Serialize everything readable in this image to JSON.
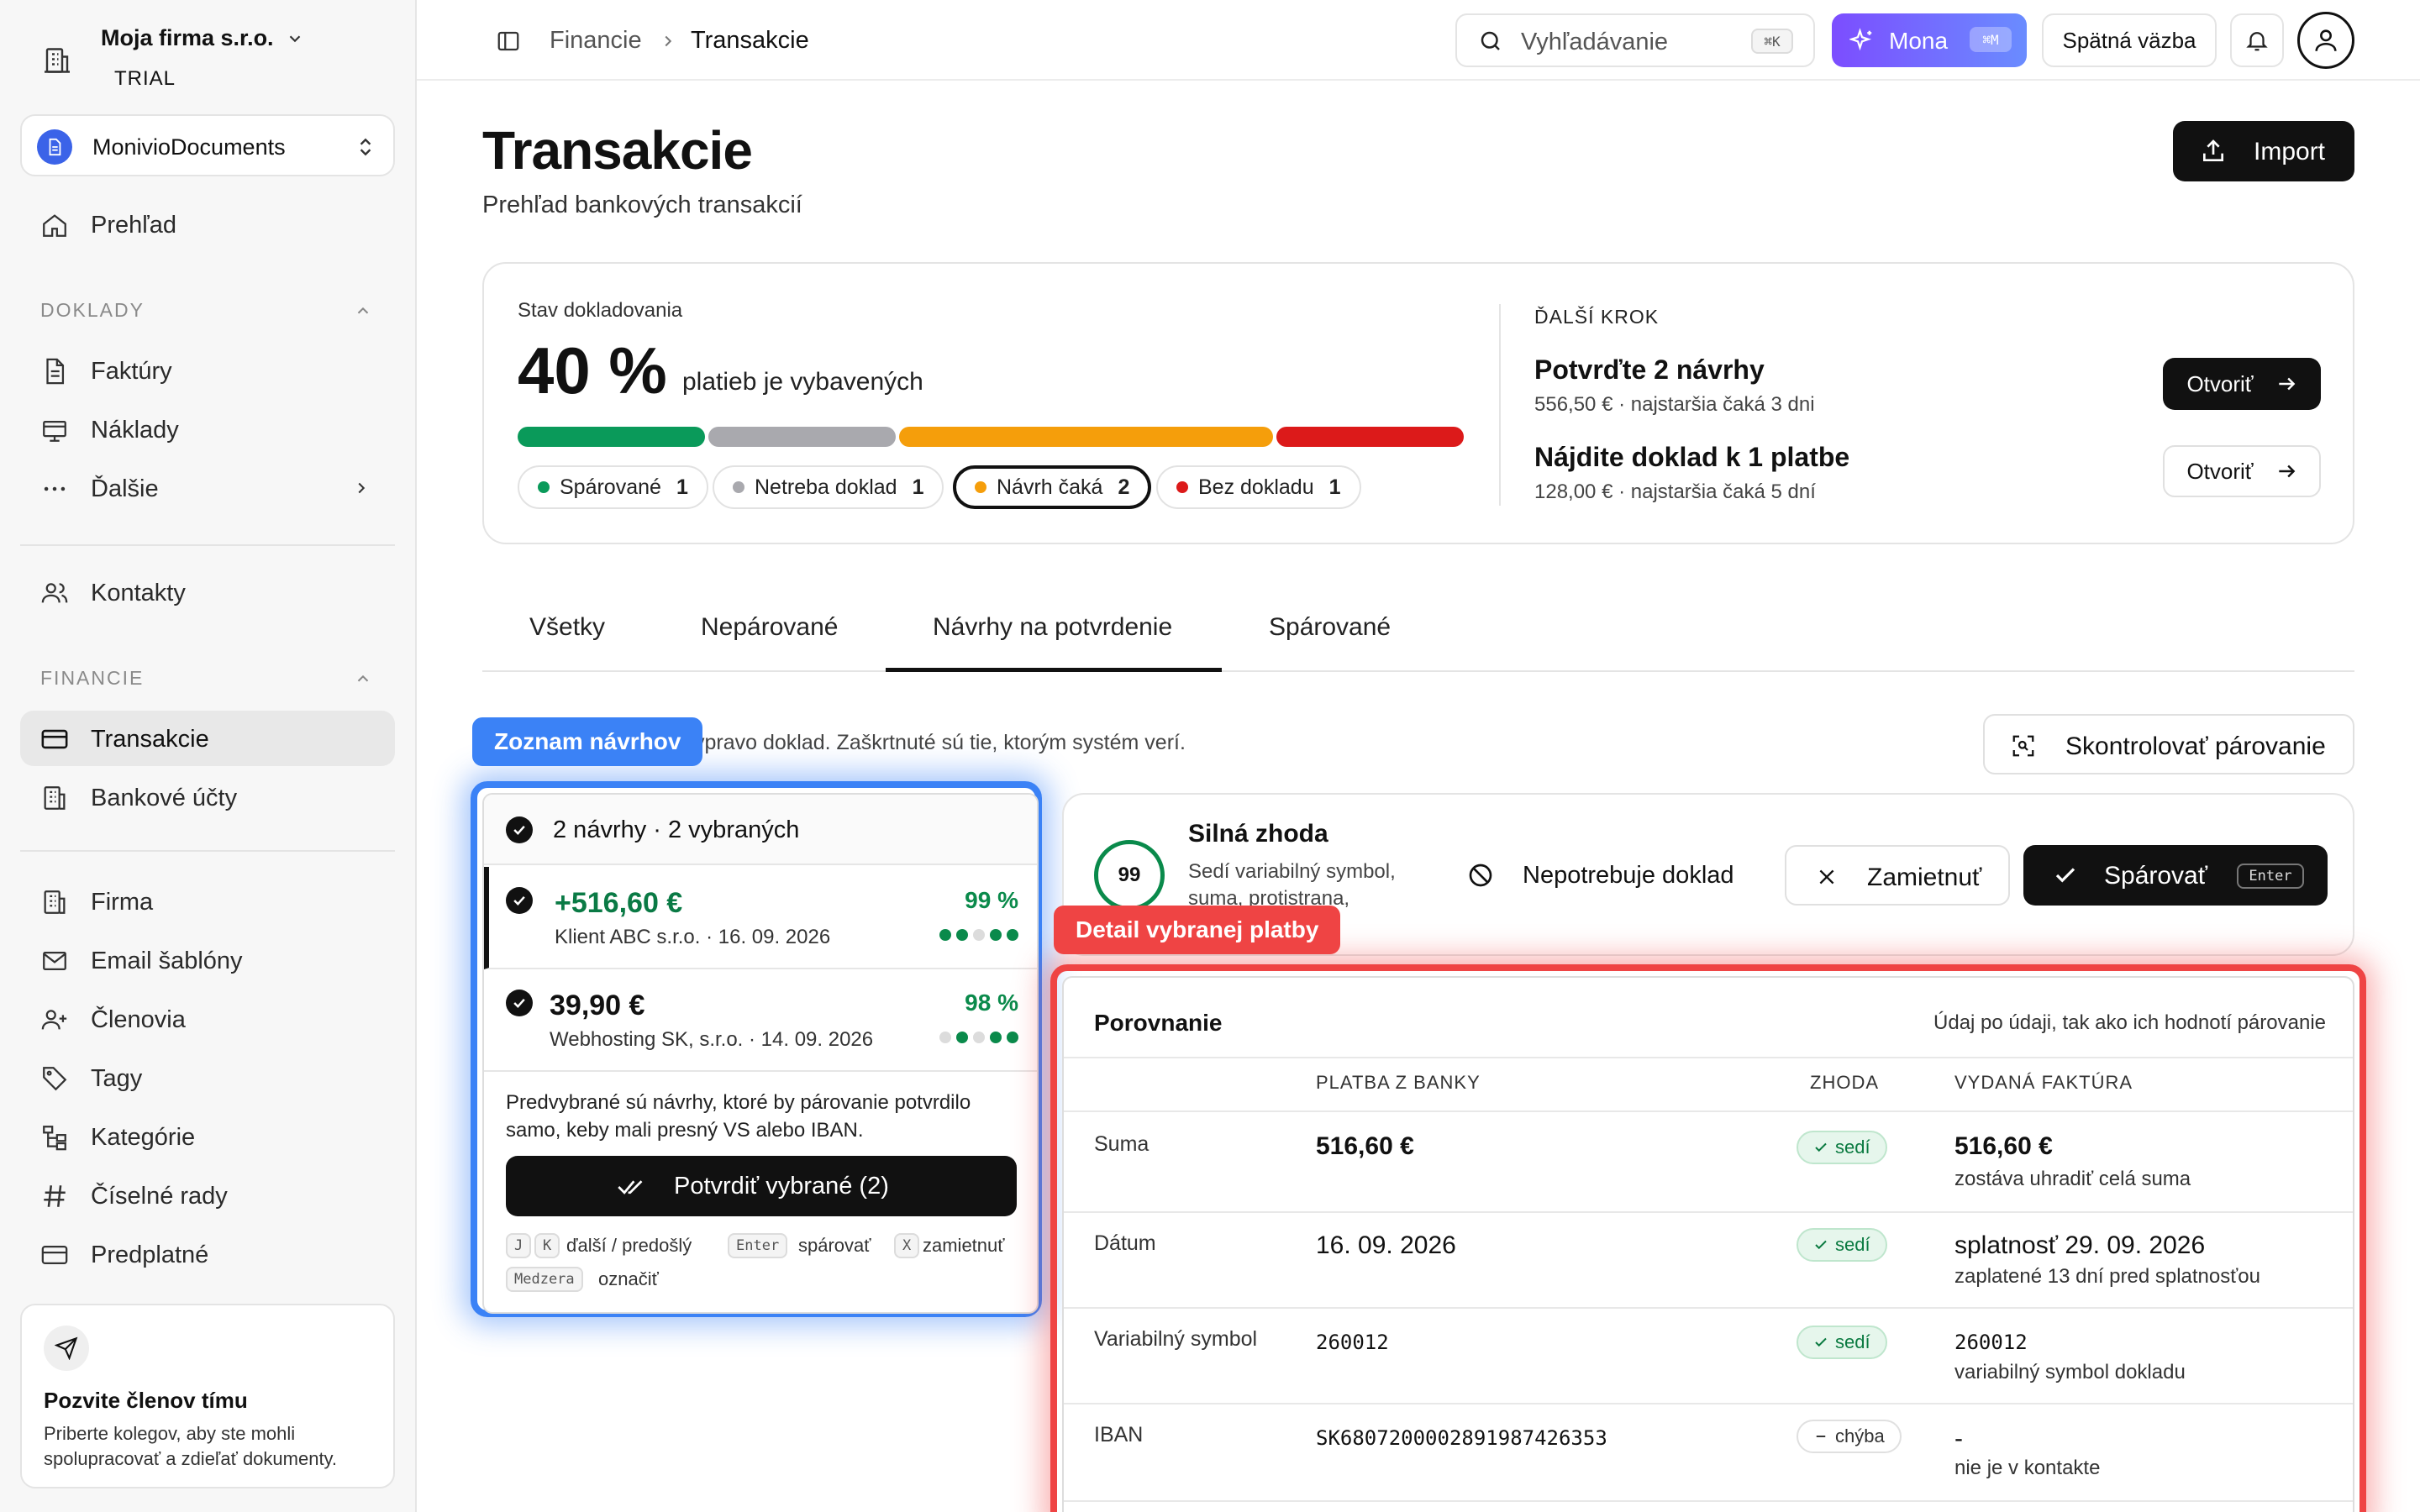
{
  "sidebar": {
    "org_name": "Moja firma s.r.o.",
    "org_plan": "TRIAL",
    "workspace": "MonivioDocuments",
    "overview": "Prehľad",
    "section_docs": "DOKLADY",
    "invoices": "Faktúry",
    "costs": "Náklady",
    "more": "Ďalšie",
    "contacts": "Kontakty",
    "section_finance": "FINANCIE",
    "transactions": "Transakcie",
    "bank_accounts": "Bankové účty",
    "company": "Firma",
    "email_templates": "Email šablóny",
    "members": "Členovia",
    "tags": "Tagy",
    "categories": "Kategórie",
    "number_series": "Číselné rady",
    "subscription": "Predplatné",
    "invite_title": "Pozvite členov tímu",
    "invite_text": "Priberte kolegov, aby ste mohli spolupracovať a zdieľať dokumenty."
  },
  "topbar": {
    "breadcrumb_root": "Financie",
    "breadcrumb_current": "Transakcie",
    "search_placeholder": "Vyhľadávanie",
    "search_shortcut": "⌘K",
    "assistant_label": "Mona",
    "assistant_shortcut": "⌘M",
    "feedback_label": "Spätná väzba"
  },
  "page": {
    "title": "Transakcie",
    "subtitle": "Prehľad bankových transakcií",
    "import_label": "Import"
  },
  "status": {
    "label": "Stav dokladovania",
    "percent": "40 %",
    "percent_text": "platieb je vybavených",
    "segments": [
      {
        "share": 0.2,
        "color": "#0a9a5a"
      },
      {
        "share": 0.2,
        "color": "#a9a9ae"
      },
      {
        "share": 0.4,
        "color": "#f59e0b"
      },
      {
        "share": 0.2,
        "color": "#dc1a1a"
      }
    ],
    "chips": [
      {
        "label": "Spárované",
        "count": "1",
        "color": "#0a9a5a"
      },
      {
        "label": "Netreba doklad",
        "count": "1",
        "color": "#a9a9ae"
      },
      {
        "label": "Návrh čaká",
        "count": "2",
        "color": "#f59e0b"
      },
      {
        "label": "Bez dokladu",
        "count": "1",
        "color": "#dc1a1a"
      }
    ]
  },
  "next_step": {
    "label": "ĎALŠÍ KROK",
    "items": [
      {
        "title": "Potvrďte 2 návrhy",
        "sub": "556,50 € · najstaršia čaká 3 dni",
        "action": "Otvoriť"
      },
      {
        "title": "Nájdite doklad k 1 platbe",
        "sub": "128,00 € · najstaršia čaká 5 dní",
        "action": "Otvoriť"
      }
    ]
  },
  "tabs": [
    "Všetky",
    "Nepárované",
    "Návrhy na potvrdenie",
    "Spárované"
  ],
  "helper_text": "vpravo doklad. Zaškrtnuté sú tie, ktorým systém verí.",
  "check_pairing_label": "Skontrolovať párovanie",
  "overlay": {
    "list_tag": "Zoznam návrhov",
    "detail_tag": "Detail vybranej platby"
  },
  "proposals": {
    "header": "2 návrhy · 2 vybraných",
    "items": [
      {
        "amount": "+516,60 €",
        "desc": "Klient ABC s.r.o. · 16. 09. 2026",
        "score": "99 %"
      },
      {
        "amount": "39,90 €",
        "desc": "Webhosting SK, s.r.o. · 14. 09. 2026",
        "score": "98 %"
      }
    ],
    "note": "Predvybrané sú návrhy, ktoré by párovanie potvrdilo samo, keby mali presný VS alebo IBAN.",
    "confirm_label": "Potvrdiť vybrané (2)",
    "shortcuts": {
      "k1": "J",
      "k2": "K",
      "t1": "ďalší / predošlý",
      "k3": "Enter",
      "t2": "spárovať",
      "k4": "X",
      "t3": "zamietnuť",
      "k5": "Medzera",
      "t4": "označiť"
    }
  },
  "match": {
    "score": "99",
    "title": "Silná zhoda",
    "sub": "Sedí variabilný symbol, suma, protistrana,",
    "not_needed_label": "Nepotrebuje doklad",
    "reject_label": "Zamietnuť",
    "pair_label": "Spárovať",
    "pair_shortcut": "Enter"
  },
  "comparison": {
    "title": "Porovnanie",
    "subtitle": "Údaj po údaji, tak ako ich hodnotí párovanie",
    "col_bank": "PLATBA Z BANKY",
    "col_match": "ZHODA",
    "col_invoice": "VYDANÁ FAKTÚRA",
    "rows": [
      {
        "label": "Suma",
        "bank": "516,60 €",
        "status": "sedí",
        "invoice": "516,60 €",
        "invoice_sub": "zostáva uhradiť celá suma"
      },
      {
        "label": "Dátum",
        "bank": "16. 09. 2026",
        "status": "sedí",
        "invoice": "splatnosť 29. 09. 2026",
        "invoice_sub": "zaplatené 13 dní pred splatnosťou"
      },
      {
        "label": "Variabilný symbol",
        "bank": "260012",
        "status": "sedí",
        "invoice": "260012",
        "invoice_sub": "variabilný symbol dokladu"
      },
      {
        "label": "IBAN",
        "bank": "SK6807200002891987426353",
        "status": "chýba",
        "invoice": "-",
        "invoice_sub": "nie je v kontakte"
      }
    ]
  }
}
